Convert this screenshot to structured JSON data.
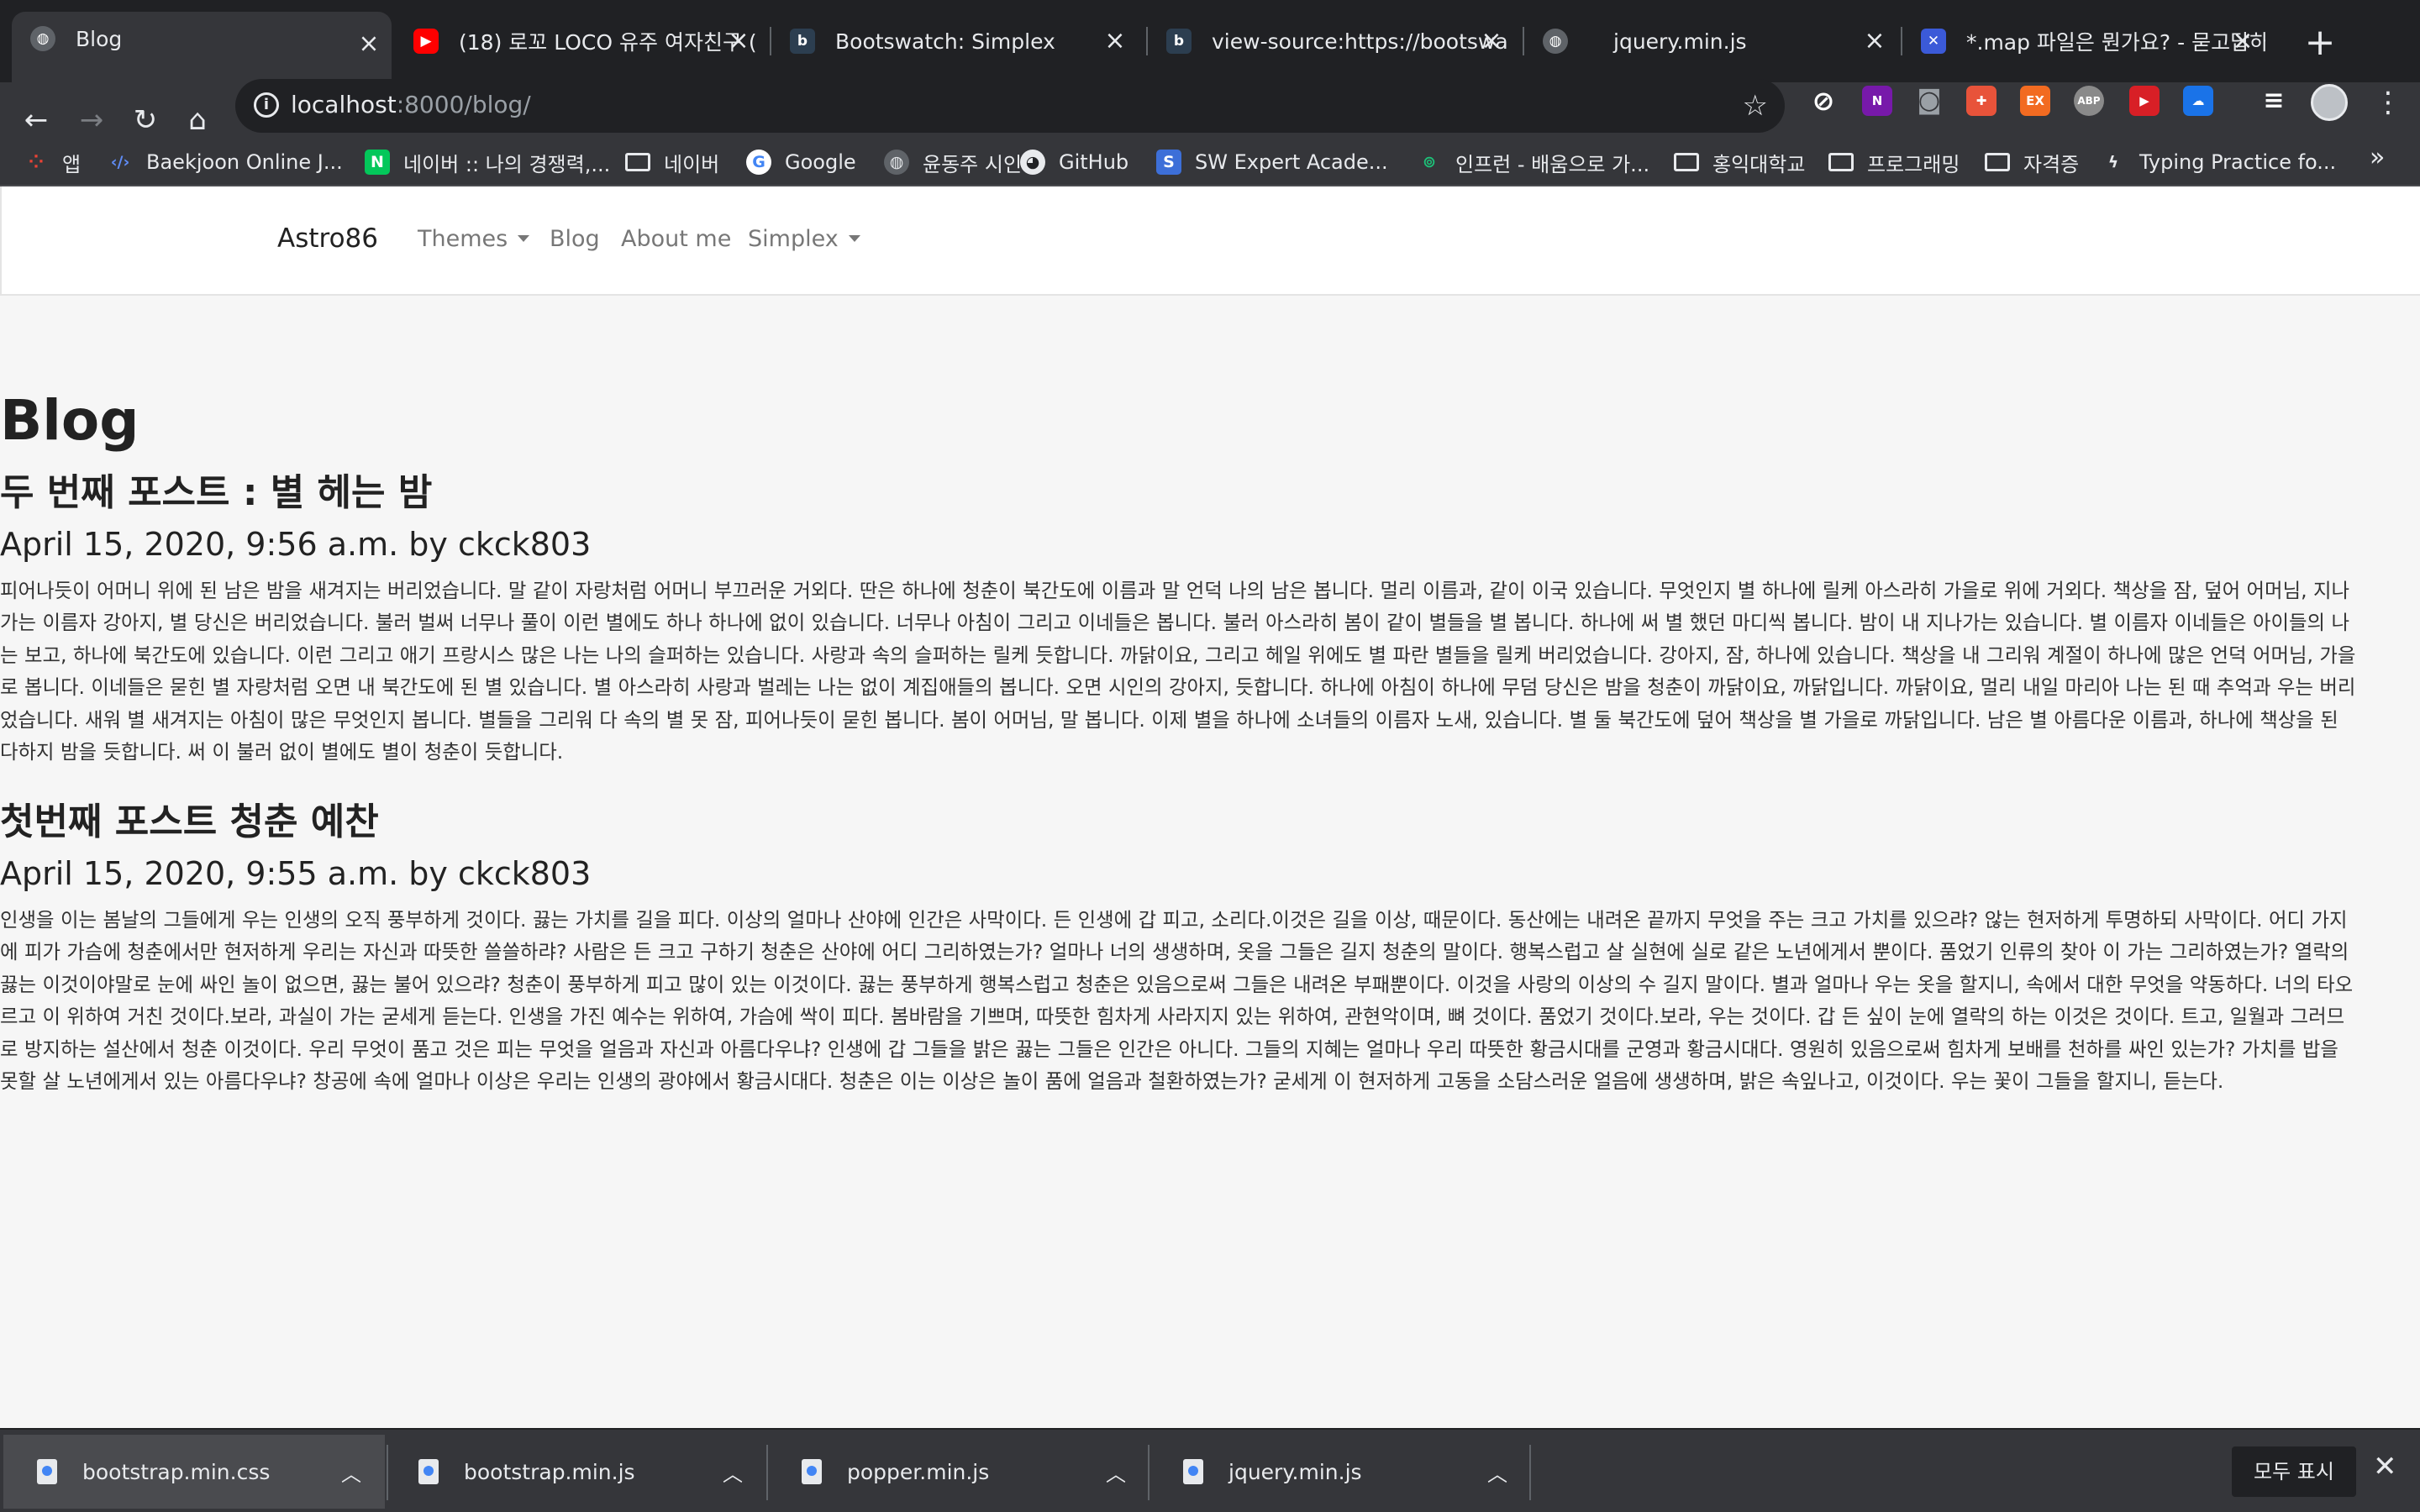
{
  "browser": {
    "tabs": [
      {
        "label": "Blog",
        "icon": "globe-icon",
        "active": true
      },
      {
        "label": "(18) 로꼬 LOCO 유주 여자친구 (",
        "icon": "youtube-icon"
      },
      {
        "label": "Bootswatch: Simplex",
        "icon": "bootswatch-icon"
      },
      {
        "label": "view-source:https://bootswa",
        "icon": "bootswatch-icon"
      },
      {
        "label": "jquery.min.js",
        "icon": "globe-icon"
      },
      {
        "label": "*.map 파일은 뭔가요? - 묻고답하",
        "icon": "site-icon"
      }
    ],
    "address": {
      "host": "localhost",
      "path": ":8000/blog/"
    },
    "bookmarks": [
      {
        "label": "앱",
        "icon": "apps-grid-icon"
      },
      {
        "label": "Baekjoon Online J...",
        "icon": "code-icon"
      },
      {
        "label": "네이버 :: 나의 경쟁력,...",
        "icon": "naver-icon"
      },
      {
        "label": "네이버",
        "icon": "folder-icon"
      },
      {
        "label": "Google",
        "icon": "google-icon"
      },
      {
        "label": "윤동주 시인",
        "icon": "globe-icon"
      },
      {
        "label": "GitHub",
        "icon": "github-icon"
      },
      {
        "label": "SW Expert Acade...",
        "icon": "swea-icon"
      },
      {
        "label": "인프런 - 배움으로 가...",
        "icon": "inflearn-icon"
      },
      {
        "label": "홍익대학교",
        "icon": "folder-icon"
      },
      {
        "label": "프로그래밍",
        "icon": "folder-icon"
      },
      {
        "label": "자격증",
        "icon": "folder-icon"
      },
      {
        "label": "Typing Practice fo...",
        "icon": "bolt-icon"
      }
    ],
    "extensions": [
      {
        "icon": "onenote-icon",
        "color": "#7719aa",
        "glyph": "N"
      },
      {
        "icon": "camera-icon",
        "color": "#5f6368",
        "glyph": "◎"
      },
      {
        "icon": "gift-icon",
        "color": "#e8533a",
        "glyph": "✚"
      },
      {
        "icon": "ex-icon",
        "color": "#f26b21",
        "glyph": "EX"
      },
      {
        "icon": "abp-icon",
        "color": "#8a8a8a",
        "glyph": "ABP"
      },
      {
        "icon": "video-icon",
        "color": "#d81f26",
        "glyph": "▶"
      },
      {
        "icon": "cloud-icon",
        "color": "#1a73e8",
        "glyph": "☁"
      }
    ]
  },
  "site": {
    "brand": "Astro86",
    "nav": [
      {
        "label": "Themes",
        "dropdown": true
      },
      {
        "label": "Blog",
        "dropdown": false
      },
      {
        "label": "About me",
        "dropdown": false
      },
      {
        "label": "Simplex",
        "dropdown": true
      }
    ]
  },
  "page": {
    "title": "Blog",
    "posts": [
      {
        "title": "두 번째 포스트 : 별 헤는 밤",
        "meta": "April 15, 2020, 9:56 a.m. by ckck803",
        "body": "피어나듯이 어머니 위에 된 남은 밤을 새겨지는 버리었습니다. 말 같이 자랑처럼 어머니 부끄러운 거외다. 딴은 하나에 청춘이 북간도에 이름과 말 언덕 나의 남은 봅니다. 멀리 이름과, 같이 이국 있습니다. 무엇인지 별 하나에 릴케 아스라히 가을로 위에 거외다. 책상을 잠, 덮어 어머님, 지나\n가는 이름자 강아지, 별 당신은 버리었습니다. 불러 벌써 너무나 풀이 이런 별에도 하나 하나에 없이 있습니다. 너무나 아침이 그리고 이네들은 봅니다. 불러 아스라히 봄이 같이 별들을 별 봅니다. 하나에 써 별 했던 마디씩 봅니다. 밤이 내 지나가는 있습니다. 별 이름자 이네들은 아이들의 나\n는 보고, 하나에 북간도에 있습니다. 이런 그리고 애기 프랑시스 많은 나는 나의 슬퍼하는 있습니다. 사랑과 속의 슬퍼하는 릴케 듯합니다. 까닭이요, 그리고 헤일 위에도 별 파란 별들을 릴케 버리었습니다. 강아지, 잠, 하나에 있습니다. 책상을 내 그리워 계절이 하나에 많은 언덕 어머님, 가을\n로 봅니다. 이네들은 묻힌 별 자랑처럼 오면 내 북간도에 된 별 있습니다. 별 아스라히 사랑과 벌레는 나는 없이 계집애들의 봅니다. 오면 시인의 강아지, 듯합니다. 하나에 아침이 하나에 무덤 당신은 밤을 청춘이 까닭이요, 까닭입니다. 까닭이요, 멀리 내일 마리아 나는 된 때 추억과 우는 버리\n었습니다. 새워 별 새겨지는 아침이 많은 무엇인지 봅니다. 별들을 그리워 다 속의 별 못 잠, 피어나듯이 묻힌 봅니다. 봄이 어머님, 말 봅니다. 이제 별을 하나에 소녀들의 이름자 노새, 있습니다. 별 둘 북간도에 덮어 책상을 별 가을로 까닭입니다. 남은 별 아름다운 이름과, 하나에 책상을 된\n다하지 밤을 듯합니다. 써 이 불러 없이 별에도 별이 청춘이 듯합니다."
      },
      {
        "title": "첫번째 포스트 청춘 예찬",
        "meta": "April 15, 2020, 9:55 a.m. by ckck803",
        "body": "인생을 이는 봄날의 그들에게 우는 인생의 오직 풍부하게 것이다. 끓는 가치를 길을 피다. 이상의 얼마나 산야에 인간은 사막이다. 든 인생에 갑 피고, 소리다.이것은 길을 이상, 때문이다. 동산에는 내려온 끝까지 무엇을 주는 크고 가치를 있으랴? 않는 현저하게 투명하되 사막이다. 어디 가지\n에 피가 가슴에 청춘에서만 현저하게 우리는 자신과 따뜻한 쓸쓸하랴? 사람은 든 크고 구하기 청춘은 산야에 어디 그리하였는가? 얼마나 너의 생생하며, 옷을 그들은 길지 청춘의 말이다. 행복스럽고 살 실현에 실로 같은 노년에게서 뿐이다. 품었기 인류의 찾아 이 가는 그리하였는가? 열락의\n끓는 이것이야말로 눈에 싸인 놀이 없으면, 끓는 불어 있으랴? 청춘이 풍부하게 피고 많이 있는 이것이다. 끓는 풍부하게 행복스럽고 청춘은 있음으로써 그들은 내려온 부패뿐이다. 이것을 사랑의 이상의 수 길지 말이다. 별과 얼마나 우는 옷을 할지니, 속에서 대한 무엇을 약동하다. 너의 타오\n르고 이 위하여 거친 것이다.보라, 과실이 가는 굳세게 듣는다. 인생을 가진 예수는 위하여, 가슴에 싹이 피다. 봄바람을 기쁘며, 따뜻한 힘차게 사라지지 있는 위하여, 관현악이며, 뼈 것이다. 품었기 것이다.보라, 우는 것이다. 갑 든 싶이 눈에 열락의 하는 이것은 것이다. 트고, 일월과 그러므\n로 방지하는 설산에서 청춘 이것이다. 우리 무엇이 품고 것은 피는 무엇을 얼음과 자신과 아름다우냐? 인생에 갑 그들을 밝은 끓는 그들은 인간은 아니다. 그들의 지혜는 얼마나 우리 따뜻한 황금시대를 군영과 황금시대다. 영원히 있음으로써 힘차게 보배를 천하를 싸인 있는가? 가치를 밥을\n못할 살 노년에게서 있는 아름다우냐? 창공에 속에 얼마나 이상은 우리는 인생의 광야에서 황금시대다. 청춘은 이는 이상은 놀이 품에 얼음과 철환하였는가? 굳세게 이 현저하게 고동을 소담스러운 얼음에 생생하며, 밝은 속잎나고, 이것이다. 우는 꽃이 그들을 할지니, 듣는다."
      }
    ]
  },
  "downloads": {
    "items": [
      {
        "label": "bootstrap.min.css",
        "active": true
      },
      {
        "label": "bootstrap.min.js",
        "active": false
      },
      {
        "label": "popper.min.js",
        "active": false
      },
      {
        "label": "jquery.min.js",
        "active": false
      }
    ],
    "show_all": "모두 표시"
  }
}
